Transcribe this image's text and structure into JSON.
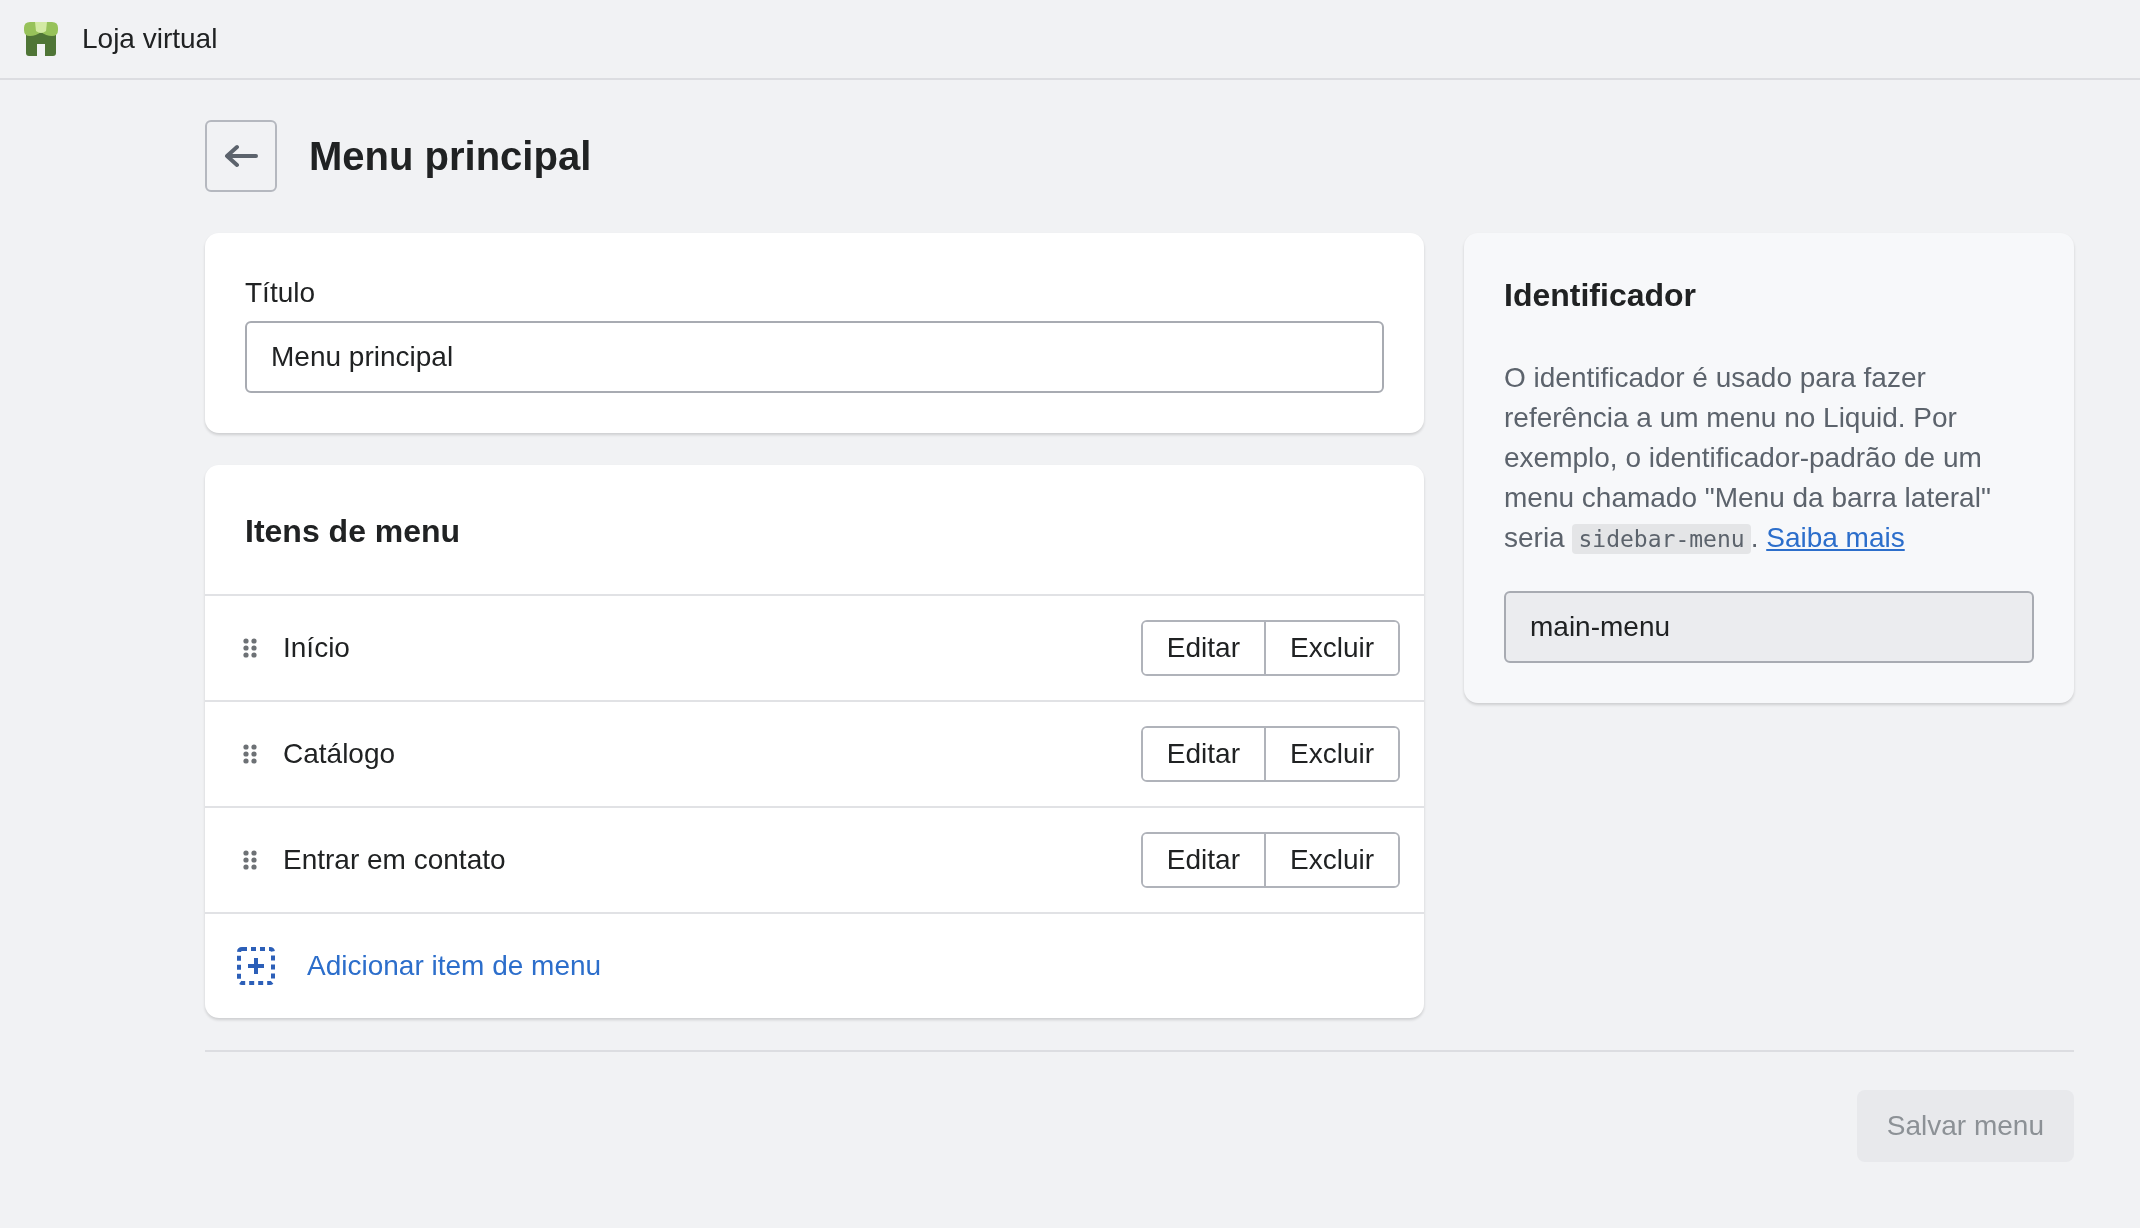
{
  "top_bar": {
    "store_name": "Loja virtual"
  },
  "page": {
    "title": "Menu principal"
  },
  "title_card": {
    "label": "Título",
    "value": "Menu principal"
  },
  "menu_items_card": {
    "heading": "Itens de menu",
    "items": [
      {
        "label": "Início",
        "edit": "Editar",
        "delete": "Excluir"
      },
      {
        "label": "Catálogo",
        "edit": "Editar",
        "delete": "Excluir"
      },
      {
        "label": "Entrar em contato",
        "edit": "Editar",
        "delete": "Excluir"
      }
    ],
    "add_link": "Adicionar item de menu"
  },
  "identifier_card": {
    "heading": "Identificador",
    "description": "O identificador é usado para fazer referência a um menu no Liquid. Por exemplo, o identificador-padrão de um menu chamado \"Menu da barra lateral\" seria",
    "code": "sidebar-menu",
    "after_code": ".",
    "link": "Saiba mais",
    "value": "main-menu",
    "disabled": true
  },
  "save_button": {
    "label": "Salvar menu",
    "disabled": true
  }
}
